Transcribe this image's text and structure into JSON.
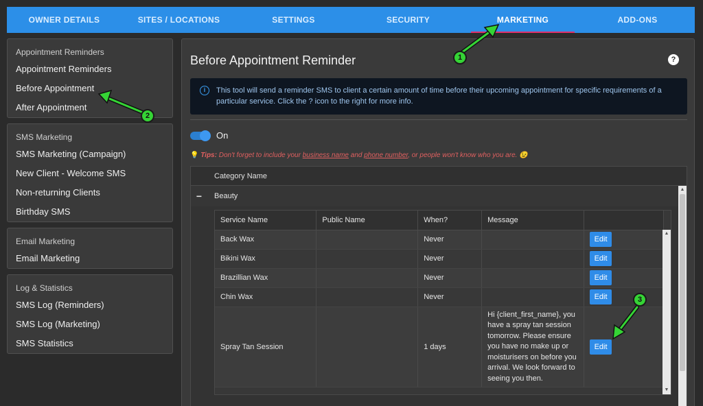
{
  "nav": {
    "tabs": [
      {
        "label": "OWNER DETAILS"
      },
      {
        "label": "SITES / LOCATIONS"
      },
      {
        "label": "SETTINGS"
      },
      {
        "label": "SECURITY"
      },
      {
        "label": "MARKETING"
      },
      {
        "label": "ADD-ONS"
      }
    ],
    "active_tab": "MARKETING"
  },
  "sidebar": {
    "groups": [
      {
        "header": "Appointment Reminders",
        "items": [
          "Appointment Reminders",
          "Before Appointment",
          "After Appointment"
        ]
      },
      {
        "header": "SMS Marketing",
        "items": [
          "SMS Marketing (Campaign)",
          "New Client - Welcome SMS",
          "Non-returning Clients",
          "Birthday SMS"
        ]
      },
      {
        "header": "Email Marketing",
        "items": [
          "Email Marketing"
        ]
      },
      {
        "header": "Log & Statistics",
        "items": [
          "SMS Log (Reminders)",
          "SMS Log (Marketing)",
          "SMS Statistics"
        ]
      }
    ]
  },
  "main": {
    "title": "Before Appointment Reminder",
    "help_glyph": "?",
    "info_text": "This tool will send a reminder SMS to client a certain amount of time before their upcoming appointment for specific requirements of a particular service. Click the ? icon to the right for more info.",
    "toggle": {
      "label": "On",
      "state": true
    },
    "tips": {
      "prefix": "Tips:",
      "text1": "Don't forget to include your",
      "link1": "business name",
      "text2": "and",
      "link2": "phone number",
      "text3": ", or people won't know who you are.",
      "emoji": "😉"
    },
    "category_header": "Category Name",
    "category": {
      "toggle": "−",
      "name": "Beauty"
    },
    "table": {
      "columns": [
        "Service Name",
        "Public Name",
        "When?",
        "Message",
        ""
      ],
      "edit_label": "Edit",
      "rows": [
        {
          "service": "Back Wax",
          "public": "",
          "when": "Never",
          "message": ""
        },
        {
          "service": "Bikini Wax",
          "public": "",
          "when": "Never",
          "message": ""
        },
        {
          "service": "Brazillian Wax",
          "public": "",
          "when": "Never",
          "message": ""
        },
        {
          "service": "Chin Wax",
          "public": "",
          "when": "Never",
          "message": ""
        },
        {
          "service": "Spray Tan Session",
          "public": "",
          "when": "1 days",
          "message": "Hi {client_first_name}, you have a spray tan session tomorrow. Please ensure you have no make up or moisturisers on before you arrival. We look forward to seeing you then."
        }
      ]
    }
  },
  "annotations": [
    {
      "label": "1"
    },
    {
      "label": "2"
    },
    {
      "label": "3"
    }
  ],
  "colors": {
    "accent": "#2c8fe8",
    "active_underline": "#e0306a",
    "annotation": "#35d435",
    "tip": "#e06060"
  }
}
